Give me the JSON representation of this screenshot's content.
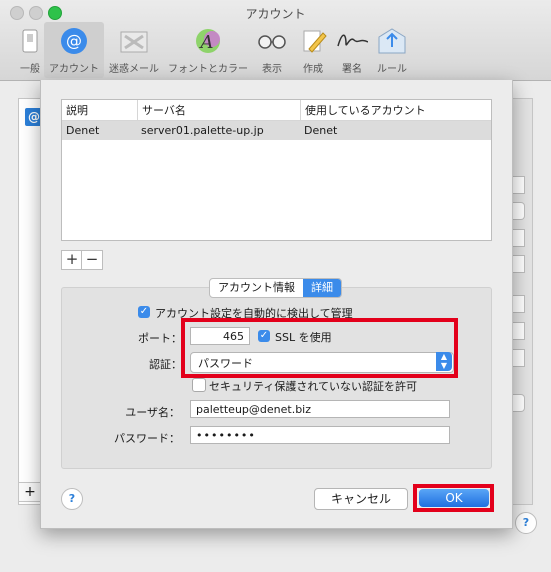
{
  "window": {
    "title": "アカウント"
  },
  "toolbar": {
    "items": [
      {
        "label": "一般",
        "icon": "switch-icon"
      },
      {
        "label": "アカウント",
        "icon": "at-icon"
      },
      {
        "label": "迷惑メール",
        "icon": "junk-mail-icon"
      },
      {
        "label": "フォントとカラー",
        "icon": "font-color-icon"
      },
      {
        "label": "表示",
        "icon": "glasses-icon"
      },
      {
        "label": "作成",
        "icon": "pencil-icon"
      },
      {
        "label": "署名",
        "icon": "signature-icon"
      },
      {
        "label": "ルール",
        "icon": "rules-icon"
      }
    ],
    "selected": "アカウント"
  },
  "server_table": {
    "columns": [
      "説明",
      "サーバ名",
      "使用しているアカウント"
    ],
    "rows": [
      [
        "Denet",
        "server01.palette-up.jp",
        "Denet"
      ]
    ]
  },
  "list_controls": {
    "add": "+",
    "remove": "−"
  },
  "tabs": {
    "items": [
      "アカウント情報",
      "詳細"
    ],
    "active": "詳細"
  },
  "advanced": {
    "auto_detect_label": "アカウント設定を自動的に検出して管理",
    "auto_detect_checked": true,
    "port_label": "ポート：",
    "port_value": "465",
    "ssl_label": "SSL を使用",
    "ssl_checked": true,
    "auth_label": "認証：",
    "auth_value": "パスワード",
    "insecure_auth_label": "セキュリティ保護されていない認証を許可",
    "insecure_auth_checked": false,
    "username_label": "ユーザ名：",
    "username_value": "paletteup@denet.biz",
    "password_label": "パスワード：",
    "password_value": "••••••••"
  },
  "buttons": {
    "help": "?",
    "cancel": "キャンセル",
    "ok": "OK"
  },
  "colors": {
    "accent": "#3b8bea",
    "highlight": "#e3001b"
  }
}
